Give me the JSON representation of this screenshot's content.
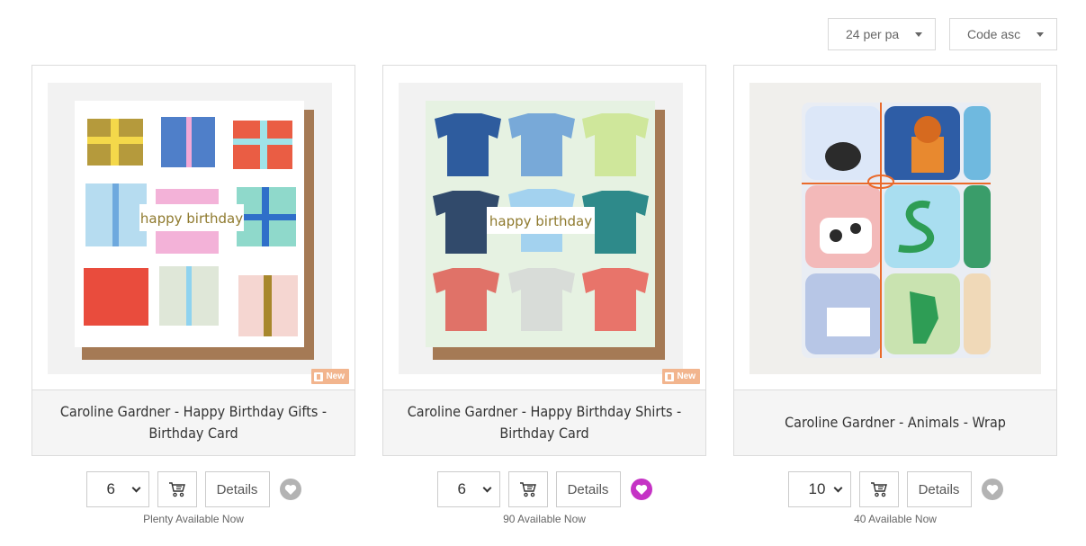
{
  "toolbar": {
    "per_page": "24 per pa",
    "sort": "Code asc"
  },
  "colors": {
    "heart_default": "#b3b3b3",
    "heart_active": "#c532c5",
    "badge_new": "#f2b58e"
  },
  "products": [
    {
      "title": "Caroline Gardner - Happy Birthday Gifts - Birthday Card",
      "card_text": "happy birthday",
      "badge": "New",
      "quantity": "6",
      "details_label": "Details",
      "availability": "Plenty Available Now",
      "favorite": false
    },
    {
      "title": "Caroline Gardner - Happy Birthday Shirts - Birthday Card",
      "card_text": "happy birthday",
      "badge": "New",
      "quantity": "6",
      "details_label": "Details",
      "availability": "90 Available Now",
      "favorite": true
    },
    {
      "title": "Caroline Gardner - Animals - Wrap",
      "badge": "",
      "quantity": "10",
      "details_label": "Details",
      "availability": "40 Available Now",
      "favorite": false
    }
  ]
}
